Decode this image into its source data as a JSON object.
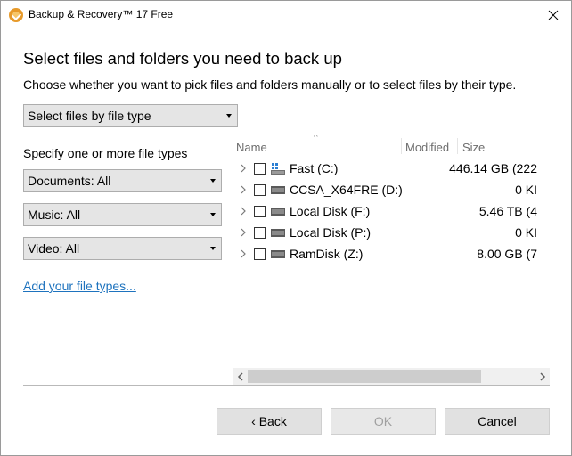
{
  "window": {
    "title": "Backup & Recovery™ 17 Free"
  },
  "page": {
    "heading": "Select files and folders you need to back up",
    "subheading": "Choose whether you want to pick files and folders manually or to select files by their type."
  },
  "mode_select": {
    "value": "Select files by file type"
  },
  "file_types": {
    "label": "Specify one or more file types",
    "documents": "Documents: All",
    "music": "Music: All",
    "video": "Video: All",
    "add_link": "Add your file types..."
  },
  "tree": {
    "columns": {
      "name": "Name",
      "modified": "Modified",
      "size": "Size"
    },
    "rows": [
      {
        "name": "Fast (C:)",
        "size": "446.14 GB (222",
        "icon": "windows-drive-icon"
      },
      {
        "name": "CCSA_X64FRE (D:)",
        "size": "0 KI",
        "icon": "drive-icon"
      },
      {
        "name": "Local Disk (F:)",
        "size": "5.46 TB (4",
        "icon": "drive-icon"
      },
      {
        "name": "Local Disk (P:)",
        "size": "0 KI",
        "icon": "drive-icon"
      },
      {
        "name": "RamDisk (Z:)",
        "size": "8.00 GB (7",
        "icon": "drive-icon"
      }
    ]
  },
  "buttons": {
    "back": "‹ Back",
    "ok": "OK",
    "cancel": "Cancel"
  },
  "colors": {
    "link": "#1e73be",
    "button": "#e1e1e1"
  }
}
